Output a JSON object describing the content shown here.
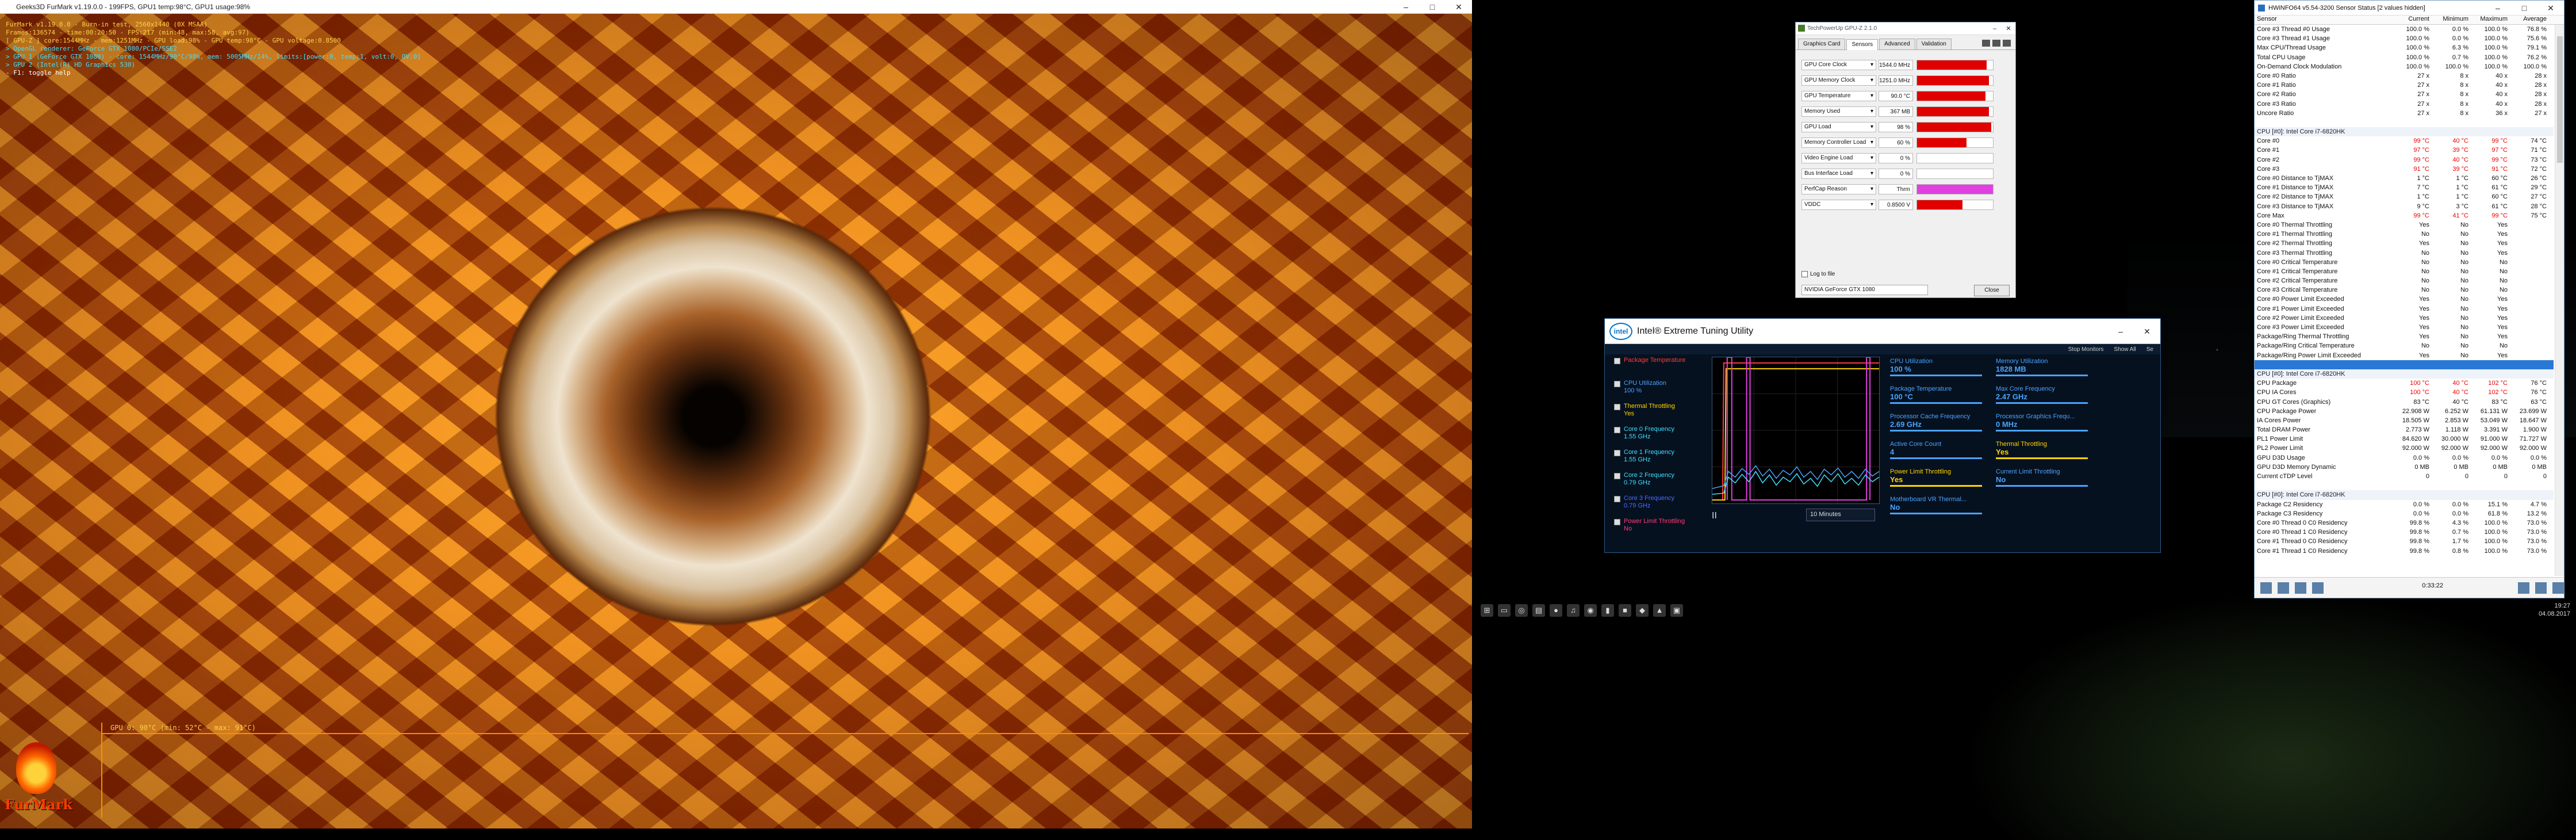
{
  "furmark": {
    "title": "Geeks3D FurMark v1.19.0.0 - 199FPS, GPU1 temp:98°C, GPU1 usage:98%",
    "overlay": [
      "FurMark v1.19.0.0 - Burn-in test, 2560x1440 (0X MSAA)",
      "Frames:136574 - time:00:20:50 - FPS:217 (min:48, max:58, avg:97)",
      "[ GPU-Z ] core:1544MHz - mem:1251MHz - GPU load:98% - GPU temp:98°C - GPU voltage:0.8500",
      "> OpenGL renderer: GeForce GTX 1080/PCIe/SSE2",
      "> GPU 1 (GeForce GTX 1080) - core: 1544MHz/90°C/98%, mem: 5005MHz/14%, limits:[power:0, temp:1, volt:0, OV:0]",
      "> GPU 2 (Intel(R) HD Graphics 530)",
      "- F1: toggle help"
    ],
    "graph_label": "GPU 0: 90°C (min: 52°C - max: 91°C)",
    "logo": "FurMark"
  },
  "gpuz": {
    "title": "TechPowerUp GPU-Z 2.1.0",
    "tabs": [
      "Graphics Card",
      "Sensors",
      "Advanced",
      "Validation"
    ],
    "active_tab": "Sensors",
    "sensors": [
      {
        "label": "GPU Core Clock",
        "value": "1544.0 MHz",
        "fill": 0.92,
        "color": "#e00000"
      },
      {
        "label": "GPU Memory Clock",
        "value": "1251.0 MHz",
        "fill": 0.95,
        "color": "#e00000"
      },
      {
        "label": "GPU Temperature",
        "value": "90.0 °C",
        "fill": 0.9,
        "color": "#e00000"
      },
      {
        "label": "Memory Used",
        "value": "367 MB",
        "fill": 0.95,
        "color": "#e00000"
      },
      {
        "label": "GPU Load",
        "value": "98 %",
        "fill": 0.98,
        "color": "#e00000"
      },
      {
        "label": "Memory Controller Load",
        "value": "60 %",
        "fill": 0.65,
        "color": "#e00000"
      },
      {
        "label": "Video Engine Load",
        "value": "0 %",
        "fill": 0,
        "color": "#e00000"
      },
      {
        "label": "Bus Interface Load",
        "value": "0 %",
        "fill": 0,
        "color": "#e00000"
      },
      {
        "label": "PerfCap Reason",
        "value": "Thrm",
        "fill": 1,
        "color": "#e040e0"
      },
      {
        "label": "VDDC",
        "value": "0.8500 V",
        "fill": 0.6,
        "color": "#e00000"
      }
    ],
    "log_to_file": "Log to file",
    "gpu_select": "NVIDIA GeForce GTX 1080",
    "close_label": "Close"
  },
  "xtu": {
    "title": "Intel® Extreme Tuning Utility",
    "logo": "intel",
    "strip": [
      "Stop Monitors",
      "Show All",
      "Se"
    ],
    "monitors": [
      {
        "name": "Package Temperature",
        "value": "",
        "color": "#ff3b3b"
      },
      {
        "name": "CPU Utilization",
        "value": "100 %",
        "color": "#4aa3ff"
      },
      {
        "name": "Thermal Throttling",
        "value": "Yes",
        "color": "#ffd400"
      },
      {
        "name": "Core 0 Frequency",
        "value": "1.55 GHz",
        "color": "#3fe0ff"
      },
      {
        "name": "Core 1 Frequency",
        "value": "1.55 GHz",
        "color": "#3fe0ff"
      },
      {
        "name": "Core 2 Frequency",
        "value": "0.79 GHz",
        "color": "#3fe0ff"
      },
      {
        "name": "Core 3 Frequency",
        "value": "0.79 GHz",
        "color": "#4a6cff"
      },
      {
        "name": "Power Limit Throttling",
        "value": "No",
        "color": "#ff3b7a"
      }
    ],
    "range": "10 Minutes",
    "pause_label": "II",
    "tiles": [
      {
        "name": "CPU Utilization",
        "value": "100 %",
        "style": "b"
      },
      {
        "name": "Memory Utilization",
        "value": "1828 MB",
        "style": "b"
      },
      {
        "name": "Package Temperature",
        "value": "100 °C",
        "style": "b"
      },
      {
        "name": "Max Core Frequency",
        "value": "2.47 GHz",
        "style": "b"
      },
      {
        "name": "Processor Cache Frequency",
        "value": "2.69 GHz",
        "style": "b"
      },
      {
        "name": "Processor Graphics Frequ...",
        "value": "0 MHz",
        "style": "b"
      },
      {
        "name": "Active Core Count",
        "value": "4",
        "style": "b"
      },
      {
        "name": "Thermal Throttling",
        "value": "Yes",
        "style": "y"
      },
      {
        "name": "Power Limit Throttling",
        "value": "Yes",
        "style": "y"
      },
      {
        "name": "Current Limit Throttling",
        "value": "No",
        "style": "b"
      },
      {
        "name": "Motherboard VR Thermal...",
        "value": "No",
        "style": "b"
      }
    ]
  },
  "hwinfo": {
    "title": "HWiNFO64 v5.54-3200 Sensor Status [2 values hidden]",
    "columns": [
      "Sensor",
      "Current",
      "Minimum",
      "Maximum",
      "Average"
    ],
    "rows": [
      [
        "Core #3 Thread #0 Usage",
        "100.0 %",
        "0.0 %",
        "100.0 %",
        "76.8 %"
      ],
      [
        "Core #3 Thread #1 Usage",
        "100.0 %",
        "0.0 %",
        "100.0 %",
        "75.6 %"
      ],
      [
        "Max CPU/Thread Usage",
        "100.0 %",
        "6.3 %",
        "100.0 %",
        "79.1 %"
      ],
      [
        "Total CPU Usage",
        "100.0 %",
        "0.7 %",
        "100.0 %",
        "76.2 %"
      ],
      [
        "On-Demand Clock Modulation",
        "100.0 %",
        "100.0 %",
        "100.0 %",
        "100.0 %"
      ],
      [
        "Core #0 Ratio",
        "27 x",
        "8 x",
        "40 x",
        "28 x"
      ],
      [
        "Core #1 Ratio",
        "27 x",
        "8 x",
        "40 x",
        "28 x"
      ],
      [
        "Core #2 Ratio",
        "27 x",
        "8 x",
        "40 x",
        "28 x"
      ],
      [
        "Core #3 Ratio",
        "27 x",
        "8 x",
        "40 x",
        "28 x"
      ],
      [
        "Uncore Ratio",
        "27 x",
        "8 x",
        "36 x",
        "27 x"
      ],
      [
        "",
        "",
        "",
        "",
        ""
      ],
      [
        "CPU [#0]: Intel Core i7-6820HK",
        "",
        "",
        "",
        "",
        "grp"
      ],
      [
        "Core #0",
        "99 °C",
        "40 °C",
        "99 °C",
        "74 °C",
        "red"
      ],
      [
        "Core #1",
        "97 °C",
        "39 °C",
        "97 °C",
        "71 °C",
        "red"
      ],
      [
        "Core #2",
        "99 °C",
        "40 °C",
        "99 °C",
        "73 °C",
        "red"
      ],
      [
        "Core #3",
        "91 °C",
        "39 °C",
        "91 °C",
        "72 °C",
        "red"
      ],
      [
        "Core #0 Distance to TjMAX",
        "1 °C",
        "1 °C",
        "60 °C",
        "26 °C"
      ],
      [
        "Core #1 Distance to TjMAX",
        "7 °C",
        "1 °C",
        "61 °C",
        "29 °C"
      ],
      [
        "Core #2 Distance to TjMAX",
        "1 °C",
        "1 °C",
        "60 °C",
        "27 °C"
      ],
      [
        "Core #3 Distance to TjMAX",
        "9 °C",
        "3 °C",
        "61 °C",
        "28 °C"
      ],
      [
        "Core Max",
        "99 °C",
        "41 °C",
        "99 °C",
        "75 °C",
        "red"
      ],
      [
        "Core #0 Thermal Throttling",
        "Yes",
        "No",
        "Yes",
        ""
      ],
      [
        "Core #1 Thermal Throttling",
        "No",
        "No",
        "Yes",
        ""
      ],
      [
        "Core #2 Thermal Throttling",
        "Yes",
        "No",
        "Yes",
        ""
      ],
      [
        "Core #3 Thermal Throttling",
        "No",
        "No",
        "Yes",
        ""
      ],
      [
        "Core #0 Critical Temperature",
        "No",
        "No",
        "No",
        ""
      ],
      [
        "Core #1 Critical Temperature",
        "No",
        "No",
        "No",
        ""
      ],
      [
        "Core #2 Critical Temperature",
        "No",
        "No",
        "No",
        ""
      ],
      [
        "Core #3 Critical Temperature",
        "No",
        "No",
        "No",
        ""
      ],
      [
        "Core #0 Power Limit Exceeded",
        "Yes",
        "No",
        "Yes",
        ""
      ],
      [
        "Core #1 Power Limit Exceeded",
        "Yes",
        "No",
        "Yes",
        ""
      ],
      [
        "Core #2 Power Limit Exceeded",
        "Yes",
        "No",
        "Yes",
        ""
      ],
      [
        "Core #3 Power Limit Exceeded",
        "Yes",
        "No",
        "Yes",
        ""
      ],
      [
        "Package/Ring Thermal Throttling",
        "Yes",
        "No",
        "Yes",
        ""
      ],
      [
        "Package/Ring Critical Temperature",
        "No",
        "No",
        "No",
        ""
      ],
      [
        "Package/Ring Power Limit Exceeded",
        "Yes",
        "No",
        "Yes",
        ""
      ],
      [
        "",
        "",
        "",
        "",
        "",
        "sel"
      ],
      [
        "CPU [#0]: Intel Core i7-6820HK",
        "",
        "",
        "",
        "",
        "grp"
      ],
      [
        "CPU Package",
        "100 °C",
        "40 °C",
        "102 °C",
        "76 °C",
        "red"
      ],
      [
        "CPU IA Cores",
        "100 °C",
        "40 °C",
        "102 °C",
        "76 °C",
        "red"
      ],
      [
        "CPU GT Cores (Graphics)",
        "83 °C",
        "40 °C",
        "83 °C",
        "63 °C"
      ],
      [
        "CPU Package Power",
        "22.908 W",
        "6.252 W",
        "61.131 W",
        "23.699 W"
      ],
      [
        "IA Cores Power",
        "18.505 W",
        "2.853 W",
        "53.049 W",
        "18.647 W"
      ],
      [
        "Total DRAM Power",
        "2.773 W",
        "1.118 W",
        "3.391 W",
        "1.900 W"
      ],
      [
        "PL1 Power Limit",
        "84.620 W",
        "30.000 W",
        "91.000 W",
        "71.727 W"
      ],
      [
        "PL2 Power Limit",
        "92.000 W",
        "92.000 W",
        "92.000 W",
        "92.000 W"
      ],
      [
        "GPU D3D Usage",
        "0.0 %",
        "0.0 %",
        "0.0 %",
        "0.0 %"
      ],
      [
        "GPU D3D Memory Dynamic",
        "0 MB",
        "0 MB",
        "0 MB",
        "0 MB"
      ],
      [
        "Current cTDP Level",
        "0",
        "0",
        "0",
        "0"
      ],
      [
        "",
        "",
        "",
        "",
        ""
      ],
      [
        "CPU [#0]: Intel Core i7-6820HK",
        "",
        "",
        "",
        "",
        "grp"
      ],
      [
        "Package C2 Residency",
        "0.0 %",
        "0.0 %",
        "15.1 %",
        "4.7 %"
      ],
      [
        "Package C3 Residency",
        "0.0 %",
        "0.0 %",
        "61.8 %",
        "13.2 %"
      ],
      [
        "Core #0 Thread 0 C0 Residency",
        "99.8 %",
        "4.3 %",
        "100.0 %",
        "73.0 %"
      ],
      [
        "Core #0 Thread 1 C0 Residency",
        "99.8 %",
        "0.7 %",
        "100.0 %",
        "73.0 %"
      ],
      [
        "Core #1 Thread 0 C0 Residency",
        "99.8 %",
        "1.7 %",
        "100.0 %",
        "73.0 %"
      ],
      [
        "Core #1 Thread 1 C0 Residency",
        "99.8 %",
        "0.8 %",
        "100.0 %",
        "73.0 %"
      ]
    ],
    "timer": "0:33:22"
  },
  "taskbar": {
    "icons": [
      "start-icon",
      "taskview-icon",
      "explorer-icon",
      "folder-icon",
      "chrome-icon",
      "spotify-icon",
      "firefox-icon",
      "xtu-icon",
      "hwinfo-icon",
      "furmark-icon",
      "gpuz-icon",
      "app-icon"
    ],
    "glyphs": [
      "⊞",
      "▭",
      "◎",
      "▤",
      "●",
      "♫",
      "◉",
      "▮",
      "■",
      "◆",
      "▲",
      "▣"
    ],
    "time": "19:27",
    "date": "04.08.2017"
  }
}
